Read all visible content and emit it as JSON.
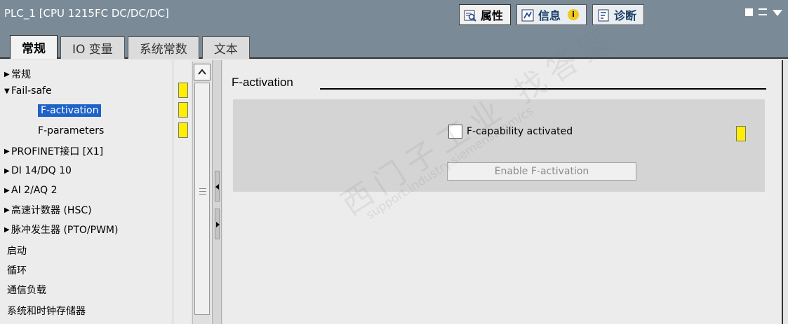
{
  "window": {
    "title": "PLC_1 [CPU 1215FC DC/DC/DC]",
    "tabs": [
      {
        "label": "属性",
        "icon": "properties-icon"
      },
      {
        "label": "信息",
        "icon": "info-icon"
      },
      {
        "label": "诊断",
        "icon": "diagnostics-icon"
      }
    ],
    "info_badge": "i"
  },
  "section_tabs": [
    "常规",
    "IO 变量",
    "系统常数",
    "文本"
  ],
  "nav": {
    "items": [
      {
        "label": "常规",
        "arrow": "▶"
      },
      {
        "label": "Fail-safe",
        "arrow": "▼"
      },
      {
        "label": "F-activation"
      },
      {
        "label": "F-parameters"
      },
      {
        "label": "PROFINET接口 [X1]",
        "arrow": "▶"
      },
      {
        "label": "DI 14/DQ 10",
        "arrow": "▶"
      },
      {
        "label": "AI 2/AQ 2",
        "arrow": "▶"
      },
      {
        "label": "高速计数器 (HSC)",
        "arrow": "▶"
      },
      {
        "label": "脉冲发生器 (PTO/PWM)",
        "arrow": "▶"
      },
      {
        "label": "启动"
      },
      {
        "label": "循环"
      },
      {
        "label": "通信负载"
      },
      {
        "label": "系统和时钟存储器"
      }
    ]
  },
  "main": {
    "section_title": "F-activation",
    "checkbox_label": "F-capability activated",
    "checkbox_checked": false,
    "enable_button": "Enable F-activation"
  },
  "watermark": {
    "cn": "西门子工业 找答案",
    "en": "support.industry.siemens.com/cs"
  },
  "colors": {
    "header": "#7a8a97",
    "selection": "#1f62c9",
    "flag": "#ffee00"
  }
}
